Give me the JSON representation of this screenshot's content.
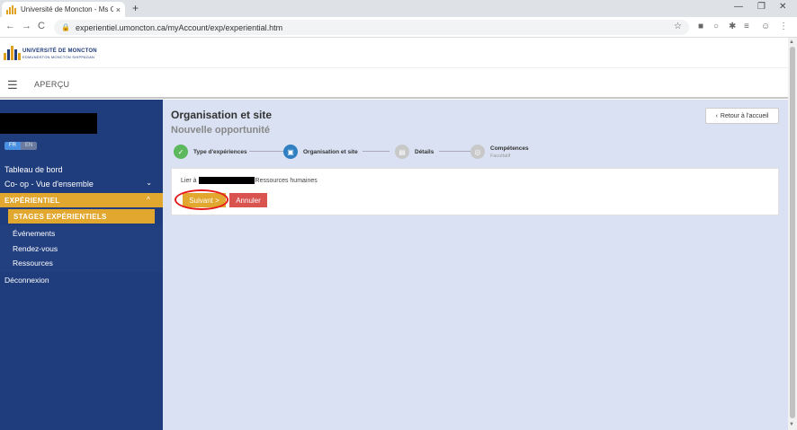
{
  "browser": {
    "tab_title": "Université de Moncton - Ms Con",
    "tab_close": "×",
    "new_tab": "+",
    "url": "experientiel.umoncton.ca/myAccount/exp/experiential.htm",
    "nav_back": "←",
    "nav_forward": "→",
    "nav_reload": "C",
    "lock": "🔒",
    "star": "☆",
    "win_min": "—",
    "win_max": "❐",
    "win_close": "✕",
    "ext_icons": [
      "■",
      "○",
      "✱",
      "≡",
      "☺",
      "⋮"
    ]
  },
  "site": {
    "logo_line1": "UNIVERSITÉ DE MONCTON",
    "logo_line2": "EDMUNDSTON MONCTON SHIPPAGAN",
    "logo_colors": [
      "#e0a020",
      "#1f3b7a",
      "#e0a020",
      "#1f3b7a",
      "#e0a020"
    ],
    "menu_icon": "☰",
    "nav_title": "APERÇU"
  },
  "sidebar": {
    "lang_on": "FR",
    "lang_off": "EN",
    "tableau": "Tableau de bord",
    "coop": "Co- op - Vue d'ensemble",
    "coop_chevron": "⌄",
    "experientiel": "EXPÉRIENTIEL",
    "experientiel_caret": "^",
    "stages": "STAGES EXPÉRIENTIELS",
    "evenements": "Événements",
    "rendezvous": "Rendez-vous",
    "ressources": "Ressources",
    "deconnexion": "Déconnexion",
    "bg_color": "#1f3c7c",
    "accent_color": "#e2a72e"
  },
  "main": {
    "title": "Organisation et site",
    "subtitle": "Nouvelle opportunité",
    "back_icon": "‹",
    "back_label": "Retour à l'accueil",
    "steps": [
      {
        "label": "Type d'expériences",
        "icon": "✓",
        "color": "#5cb85c"
      },
      {
        "label": "Organisation et site",
        "icon": "▣",
        "color": "#2f7fc1"
      },
      {
        "label": "Détails",
        "icon": "▤",
        "color": "#c8c8c8"
      },
      {
        "label": "Compétences",
        "sub": "Facultatif",
        "icon": "◎",
        "color": "#c8c8c8"
      }
    ],
    "lier_prefix": "Lier à",
    "lier_suffix": "Ressources humaines",
    "next_label": "Suivant >",
    "cancel_label": "Annuler",
    "next_color": "#e2a72e",
    "cancel_color": "#d9534f"
  }
}
